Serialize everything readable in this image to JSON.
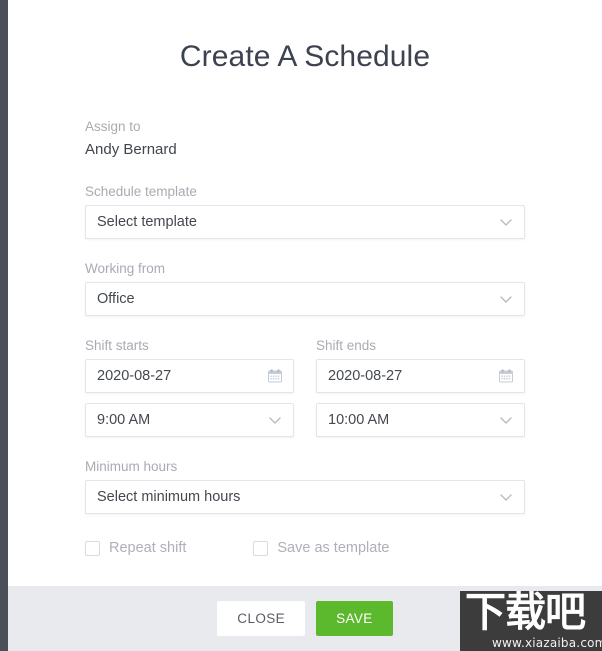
{
  "colors": {
    "accent_green": "#5cb82c",
    "footer_bg": "#e9eaee",
    "label_gray": "#a9abb3",
    "text_dark": "#41454f",
    "page_edge": "#4a4f58"
  },
  "modal": {
    "title": "Create A Schedule",
    "assign": {
      "label": "Assign to",
      "value": "Andy Bernard"
    },
    "fields": {
      "schedule_template": {
        "label": "Schedule template",
        "value": "Select template",
        "icon": "chevron-down-icon"
      },
      "working_from": {
        "label": "Working from",
        "value": "Office",
        "icon": "chevron-down-icon"
      },
      "shift_starts": {
        "label": "Shift starts",
        "date_value": "2020-08-27",
        "date_icon": "calendar-icon",
        "time_value": "9:00 AM",
        "time_icon": "chevron-down-icon"
      },
      "shift_ends": {
        "label": "Shift ends",
        "date_value": "2020-08-27",
        "date_icon": "calendar-icon",
        "time_value": "10:00 AM",
        "time_icon": "chevron-down-icon"
      },
      "minimum_hours": {
        "label": "Minimum hours",
        "value": "Select minimum hours",
        "icon": "chevron-down-icon"
      }
    },
    "checkboxes": [
      {
        "label": "Repeat shift",
        "checked": false
      },
      {
        "label": "Save as template",
        "checked": false
      }
    ],
    "footer": {
      "close_label": "CLOSE",
      "save_label": "SAVE"
    }
  },
  "watermark": {
    "chinese": "下载吧",
    "url": "www.xiazaiba.com"
  }
}
